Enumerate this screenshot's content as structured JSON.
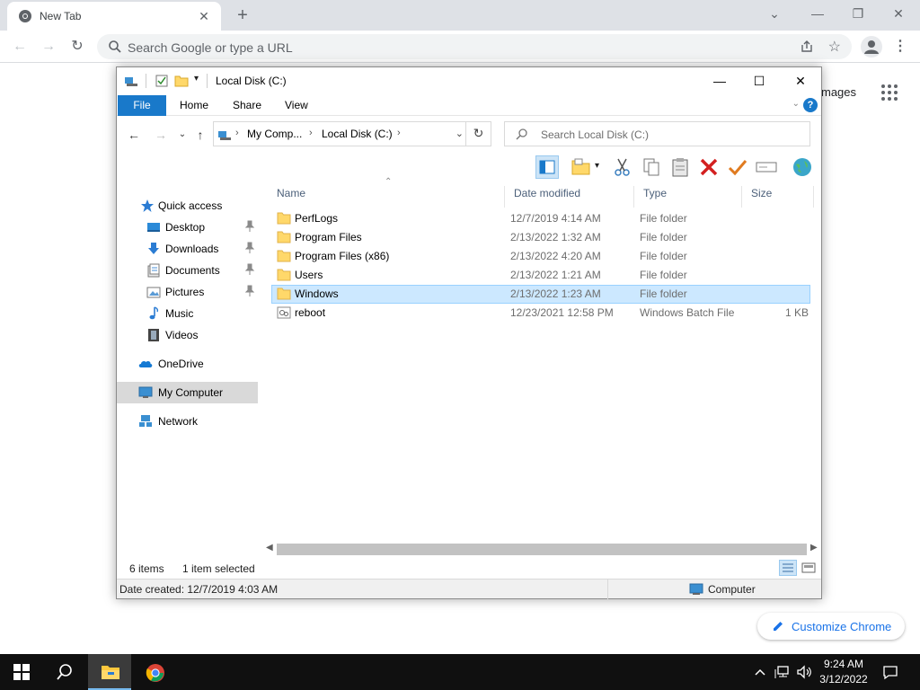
{
  "chrome": {
    "tab_title": "New Tab",
    "omnibox_placeholder": "Search Google or type a URL",
    "images_link": "mages",
    "customize_label": "Customize Chrome"
  },
  "explorer": {
    "title": "Local Disk (C:)",
    "ribbon_tabs": [
      "File",
      "Home",
      "Share",
      "View"
    ],
    "breadcrumb": [
      "My Comp...",
      "Local Disk (C:)"
    ],
    "search_placeholder": "Search Local Disk (C:)",
    "nav": {
      "quick_access": "Quick access",
      "desktop": "Desktop",
      "downloads": "Downloads",
      "documents": "Documents",
      "pictures": "Pictures",
      "music": "Music",
      "videos": "Videos",
      "onedrive": "OneDrive",
      "my_computer": "My Computer",
      "network": "Network"
    },
    "columns": {
      "name": "Name",
      "date": "Date modified",
      "type": "Type",
      "size": "Size"
    },
    "files": [
      {
        "name": "PerfLogs",
        "date": "12/7/2019 4:14 AM",
        "type": "File folder",
        "size": "",
        "kind": "folder"
      },
      {
        "name": "Program Files",
        "date": "2/13/2022 1:32 AM",
        "type": "File folder",
        "size": "",
        "kind": "folder"
      },
      {
        "name": "Program Files (x86)",
        "date": "2/13/2022 4:20 AM",
        "type": "File folder",
        "size": "",
        "kind": "folder"
      },
      {
        "name": "Users",
        "date": "2/13/2022 1:21 AM",
        "type": "File folder",
        "size": "",
        "kind": "folder"
      },
      {
        "name": "Windows",
        "date": "2/13/2022 1:23 AM",
        "type": "File folder",
        "size": "",
        "kind": "folder",
        "selected": true
      },
      {
        "name": "reboot",
        "date": "12/23/2021 12:58 PM",
        "type": "Windows Batch File",
        "size": "1 KB",
        "kind": "bat"
      }
    ],
    "status": {
      "items": "6 items",
      "selected": "1 item selected"
    },
    "details": {
      "date_created": "Date created: 12/7/2019 4:03 AM",
      "location": "Computer"
    }
  },
  "taskbar": {
    "time": "9:24 AM",
    "date": "3/12/2022"
  },
  "colors": {
    "accent": "#1979ca",
    "selection": "#cce8ff",
    "folder": "#ffd86a"
  }
}
